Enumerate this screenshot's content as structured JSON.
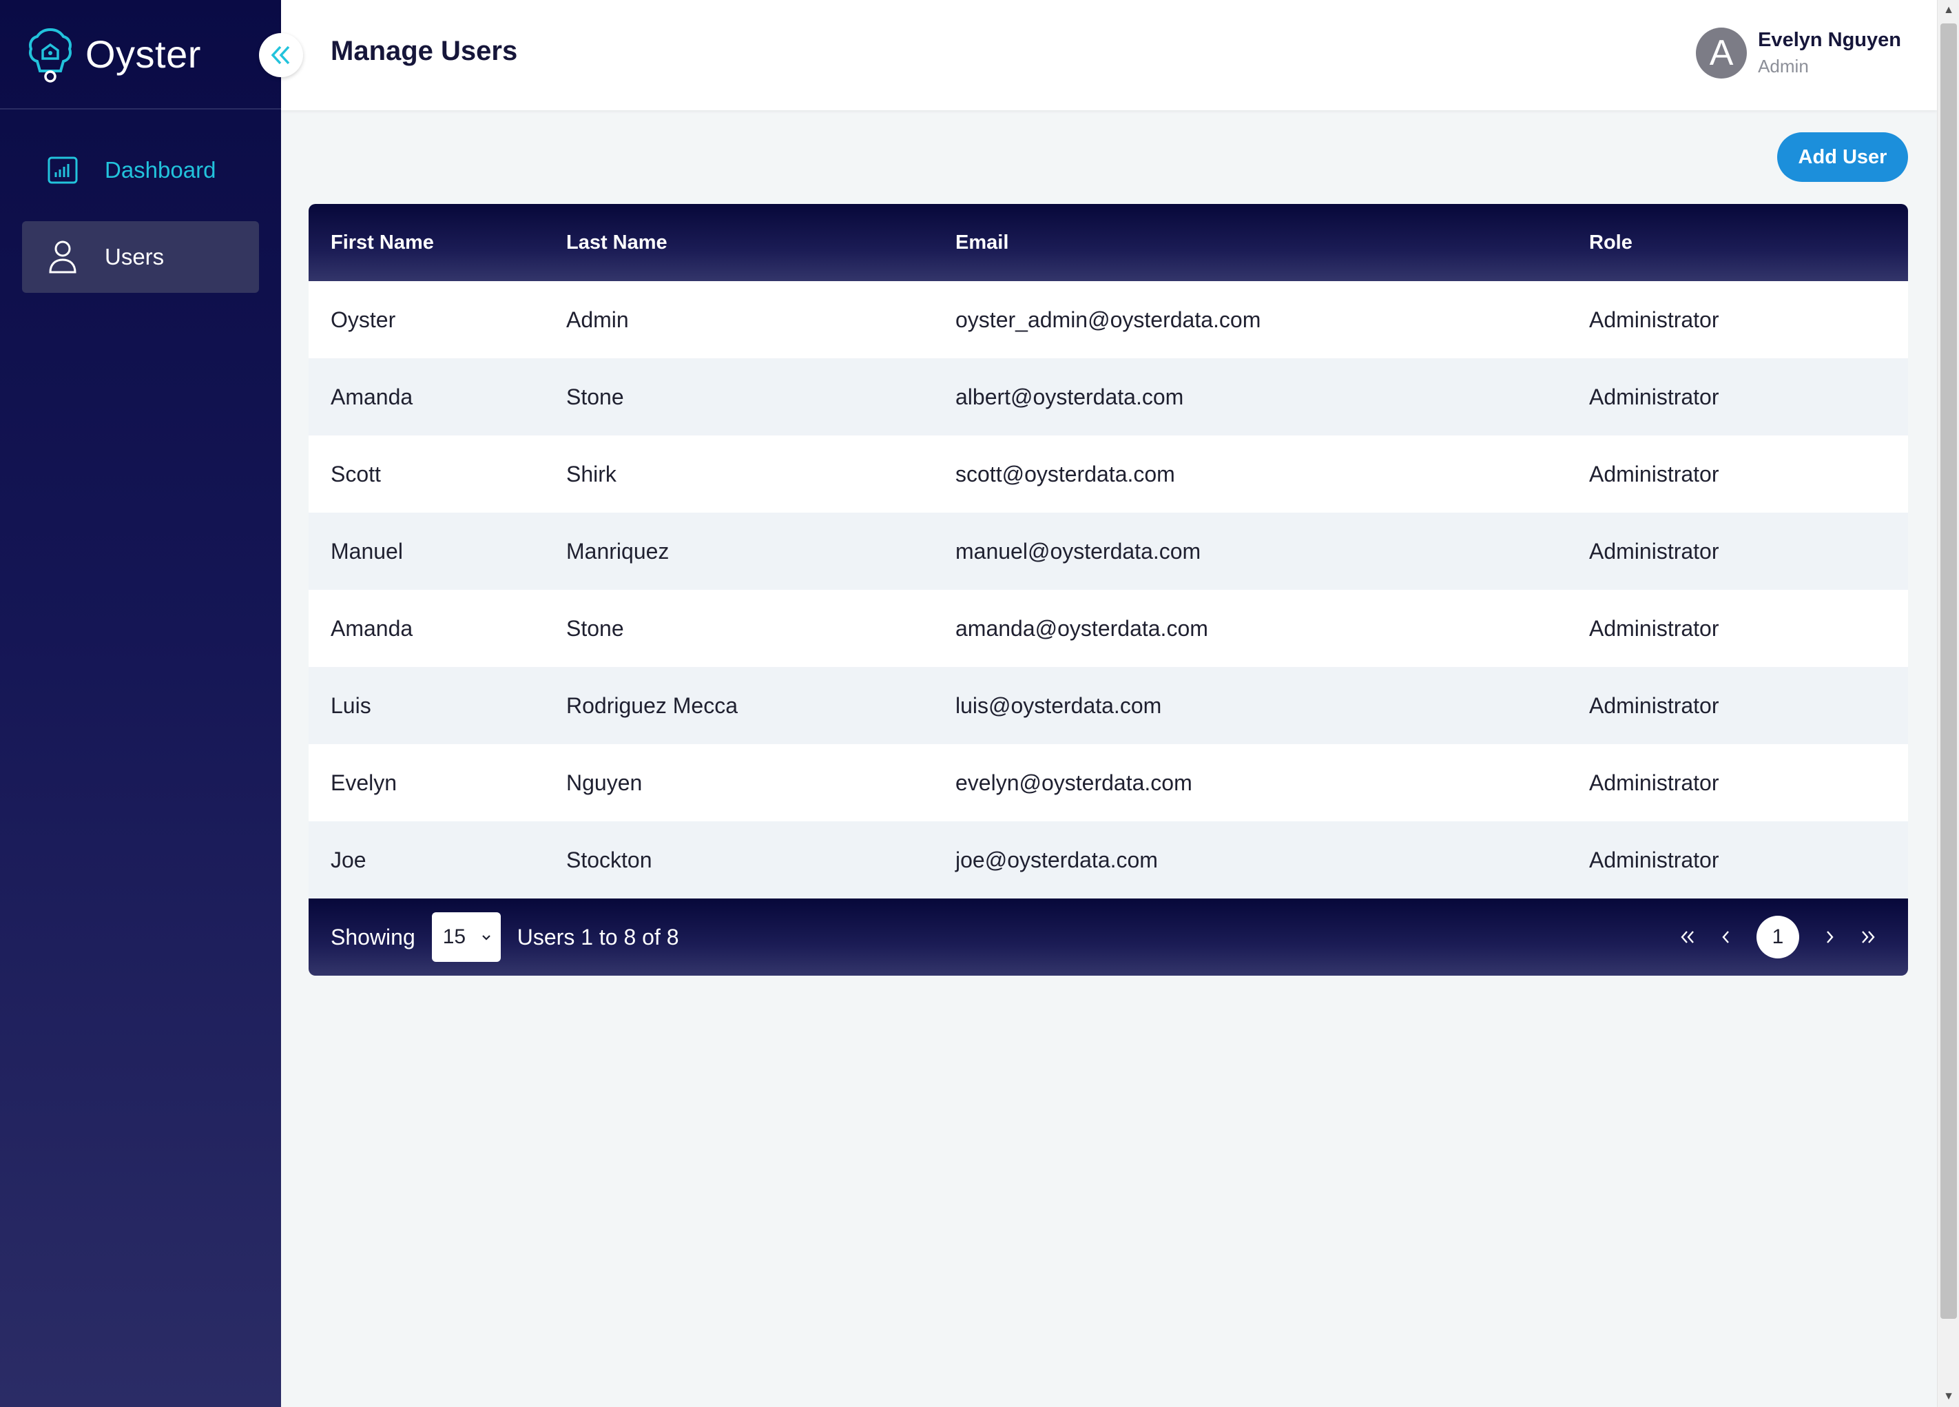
{
  "app": {
    "name": "Oyster"
  },
  "sidebar": {
    "items": [
      {
        "label": "Dashboard",
        "icon": "bar-chart-icon"
      },
      {
        "label": "Users",
        "icon": "user-icon"
      }
    ]
  },
  "header": {
    "title": "Manage Users",
    "user": {
      "avatar_letter": "A",
      "name": "Evelyn Nguyen",
      "role": "Admin"
    }
  },
  "toolbar": {
    "add_user_label": "Add User"
  },
  "table": {
    "columns": [
      "First Name",
      "Last Name",
      "Email",
      "Role"
    ],
    "rows": [
      {
        "first": "Oyster",
        "last": "Admin",
        "email": "oyster_admin@oysterdata.com",
        "role": "Administrator"
      },
      {
        "first": "Amanda",
        "last": "Stone",
        "email": "albert@oysterdata.com",
        "role": "Administrator"
      },
      {
        "first": "Scott",
        "last": "Shirk",
        "email": "scott@oysterdata.com",
        "role": "Administrator"
      },
      {
        "first": "Manuel",
        "last": "Manriquez",
        "email": "manuel@oysterdata.com",
        "role": "Administrator"
      },
      {
        "first": "Amanda",
        "last": "Stone",
        "email": "amanda@oysterdata.com",
        "role": "Administrator"
      },
      {
        "first": "Luis",
        "last": "Rodriguez Mecca",
        "email": "luis@oysterdata.com",
        "role": "Administrator"
      },
      {
        "first": "Evelyn",
        "last": "Nguyen",
        "email": "evelyn@oysterdata.com",
        "role": "Administrator"
      },
      {
        "first": "Joe",
        "last": "Stockton",
        "email": "joe@oysterdata.com",
        "role": "Administrator"
      }
    ]
  },
  "footer": {
    "showing_label": "Showing",
    "page_size": "15",
    "range_label": "Users 1 to 8 of 8",
    "current_page": "1"
  },
  "colors": {
    "sidebar_bg": "#0a0b45",
    "accent": "#22c3dc",
    "button": "#1c8fdb"
  }
}
